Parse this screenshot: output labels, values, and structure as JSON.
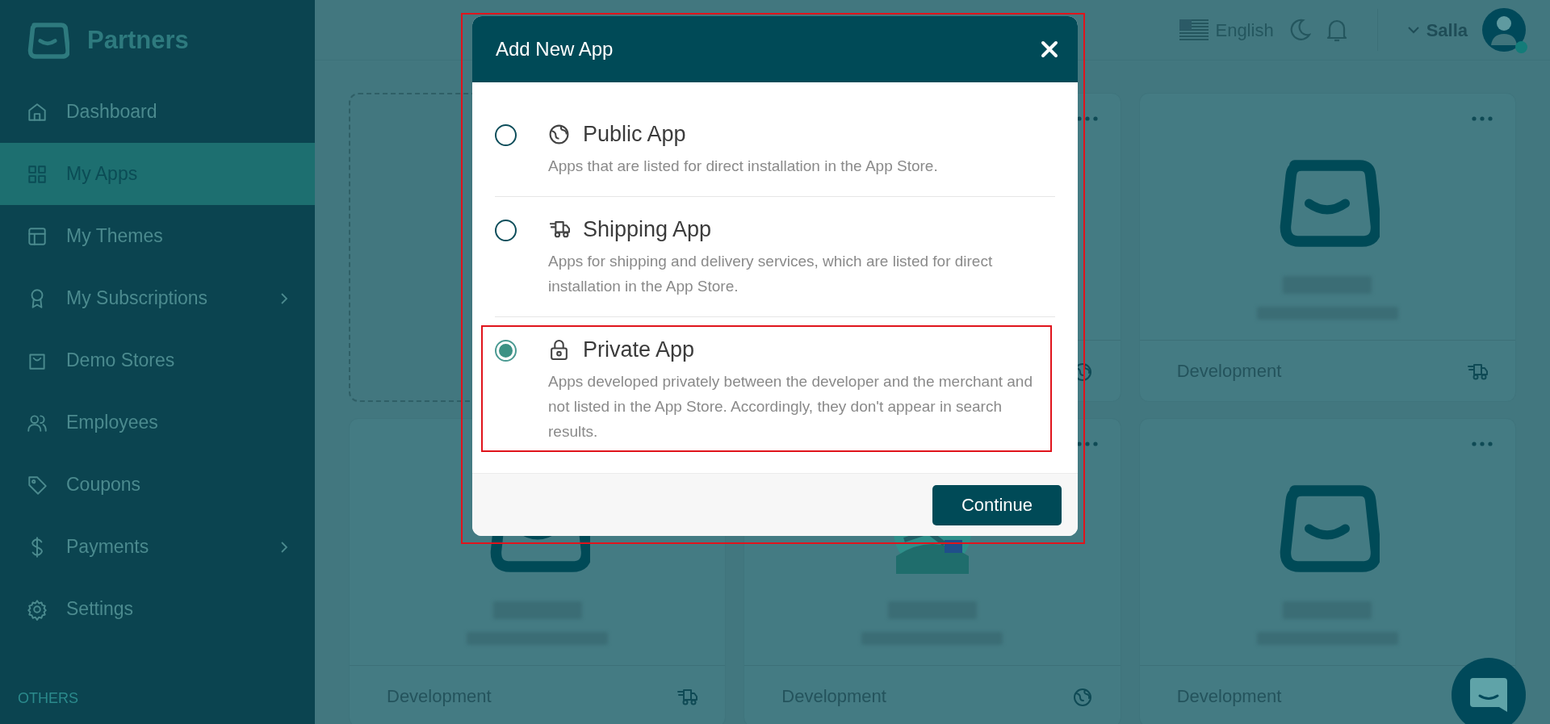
{
  "sidebar": {
    "brand": "Partners",
    "items": [
      {
        "label": "Dashboard",
        "selected": false,
        "has_submenu": false
      },
      {
        "label": "My Apps",
        "selected": true,
        "has_submenu": false
      },
      {
        "label": "My Themes",
        "selected": false,
        "has_submenu": false
      },
      {
        "label": "My Subscriptions",
        "selected": false,
        "has_submenu": true
      },
      {
        "label": "Demo Stores",
        "selected": false,
        "has_submenu": false
      },
      {
        "label": "Employees",
        "selected": false,
        "has_submenu": false
      },
      {
        "label": "Coupons",
        "selected": false,
        "has_submenu": false
      },
      {
        "label": "Payments",
        "selected": false,
        "has_submenu": true
      },
      {
        "label": "Settings",
        "selected": false,
        "has_submenu": false
      }
    ],
    "section_label": "OTHERS"
  },
  "header": {
    "language": "English",
    "user_name": "Salla",
    "user_online": true
  },
  "app_cards": [
    {
      "kind": "add"
    },
    {
      "kind": "hidden",
      "more_menu": true,
      "type_badge": {
        "kind": "public"
      }
    },
    {
      "kind": "logo",
      "more_menu": true,
      "type_badge": {
        "kind": "shipping"
      },
      "status": "Development"
    },
    {
      "kind": "logo",
      "type_badge": {
        "kind": "shipping"
      },
      "status": "Development"
    },
    {
      "kind": "picture",
      "more_menu": true,
      "type_badge": {
        "kind": "public"
      },
      "status": "Development"
    },
    {
      "kind": "logo",
      "more_menu": true,
      "status": "Development"
    }
  ],
  "modal": {
    "title": "Add New App",
    "highlighted": true,
    "options": [
      {
        "kind": "public",
        "title": "Public App",
        "description": "Apps that are listed for direct installation in the App Store.",
        "selected": false,
        "highlighted": false
      },
      {
        "kind": "shipping",
        "title": "Shipping App",
        "description": "Apps for shipping and delivery services, which are listed for direct installation in the App Store.",
        "selected": false,
        "highlighted": false
      },
      {
        "kind": "private",
        "title": "Private App",
        "description": "Apps developed privately between the developer and the merchant and not listed in the App Store. Accordingly, they don't appear in search results.",
        "selected": true,
        "highlighted": true
      }
    ],
    "button": "Continue"
  }
}
